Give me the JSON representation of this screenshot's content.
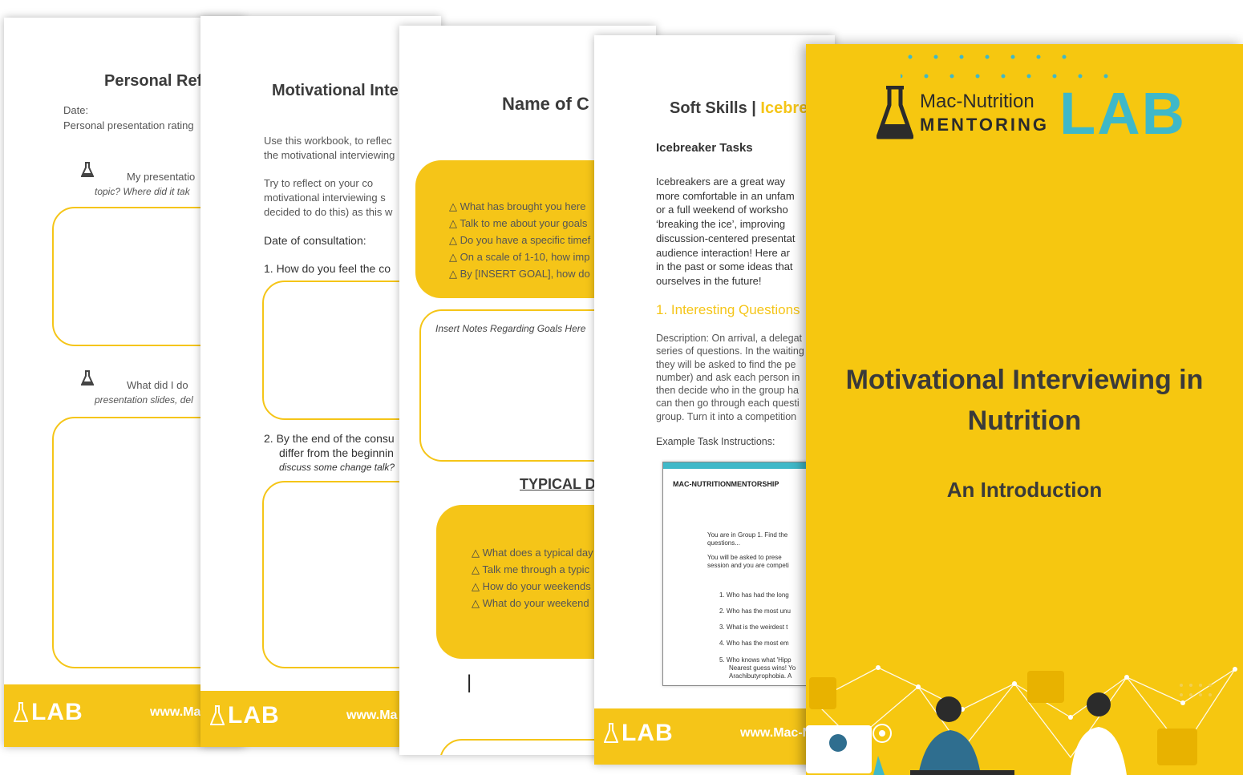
{
  "colors": {
    "accent": "#f5c518",
    "teal": "#3fb8c8",
    "title": "#3b3b3b"
  },
  "page1": {
    "title": "Personal Ref",
    "date_label": "Date:",
    "rating_label": "Personal presentation rating",
    "q1a": "My presentatio",
    "q1b": "topic? Where did it tak",
    "q2a": "What did I do",
    "q2b": "presentation slides, del",
    "footer_lab": "LAB",
    "footer_web": "www.Ma"
  },
  "page2": {
    "title": "Motivational Inte",
    "intro1": "Use this workbook, to reflec",
    "intro2": "the motivational interviewing",
    "para1": "Try to reflect on your co",
    "para2": "motivational interviewing s",
    "para3": "decided to do this) as this w",
    "date_consult": "Date of consultation:",
    "q1": "1.  How do you feel the co",
    "q2a": "2.  By the end of the consu",
    "q2b": "differ from the beginnin",
    "q2c": "discuss some change talk?",
    "footer_lab": "LAB",
    "footer_web": "www.Ma"
  },
  "page3": {
    "title": "Name of C",
    "goals": [
      "What has brought you here",
      "Talk to me about your goals",
      "Do you have a specific timef",
      "On a scale of 1-10, how imp",
      "By [INSERT GOAL], how do"
    ],
    "notes": "Insert Notes Regarding Goals Here",
    "typical": "TYPICAL D",
    "typical_items": [
      "What does a typical day",
      "Talk me through a typic",
      "How do your weekends",
      "What do your weekend"
    ],
    "cursor": "|"
  },
  "page4": {
    "title_a": "Soft Skills | ",
    "title_b": "Icebre",
    "heading": "Icebreaker Tasks",
    "para": [
      "Icebreakers are a great way",
      "more comfortable in an unfam",
      "or a full weekend of worksho",
      "‘breaking the ice’, improving",
      "discussion-centered presentat",
      "audience interaction! Here ar",
      "in the past or some ideas that",
      "ourselves in the future!"
    ],
    "section": "1. Interesting Questions",
    "desc": [
      "Description: On arrival, a delegat",
      "series of questions. In the waiting",
      "they will be asked to find the pe",
      "number) and ask each person in",
      "then decide who in the group ha",
      "can then go through each questi",
      "group. Turn it into a competition"
    ],
    "example": "Example Task Instructions:",
    "card_title": "MAC-NUTRITIONMENTORSHIP",
    "card_lines": [
      "You are in Group 1. Find the",
      "questions...",
      "You will be asked to prese",
      "session and you are competi"
    ],
    "card_list": [
      "1.  Who has had the long",
      "2.  Who has the most unu",
      "3.  What is the weirdest t",
      "4.  Who has the most em",
      "5.  Who knows what 'Hipp",
      "Nearest guess wins! Yo",
      "Arachibutyrophobia. A"
    ],
    "footer_lab": "LAB",
    "footer_web": "www.Mac-N"
  },
  "cover": {
    "brand_top": "Mac-Nutrition",
    "brand_bottom": "MENTORING",
    "brand_lab": "LAB",
    "title_line1": "Motivational Interviewing in",
    "title_line2": "Nutrition",
    "subtitle": "An Introduction"
  }
}
